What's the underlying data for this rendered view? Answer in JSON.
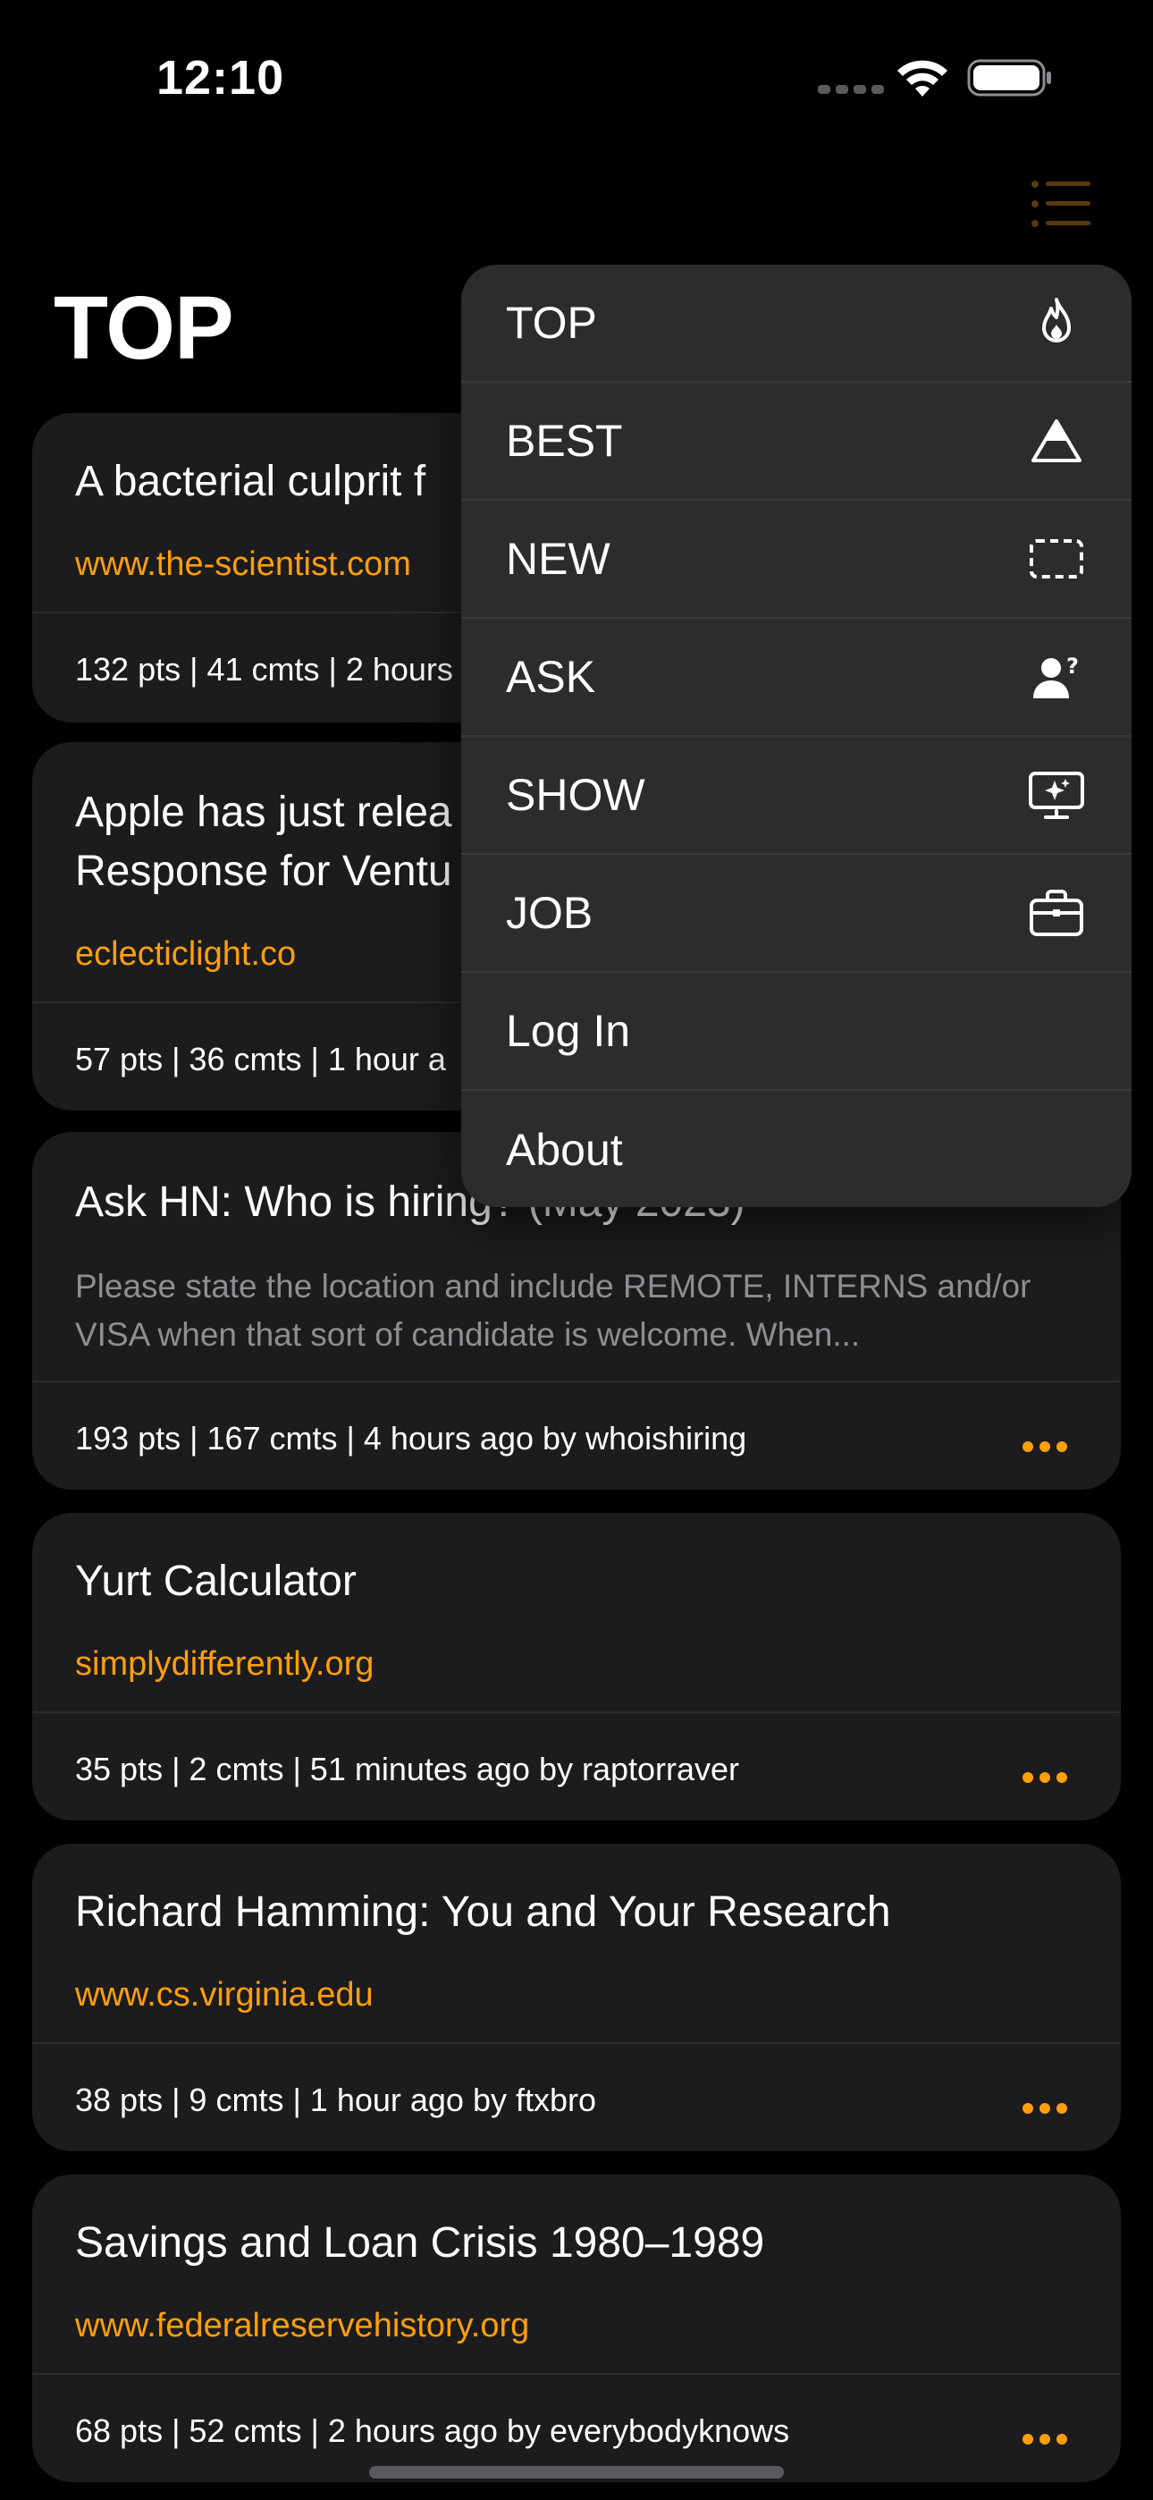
{
  "status": {
    "time": "12:10"
  },
  "page": {
    "title": "TOP"
  },
  "stories": [
    {
      "title": "A bacterial culprit f",
      "domain": "www.the-scientist.com",
      "meta": "132 pts | 41 cmts | 2 hours"
    },
    {
      "title_line1": "Apple has just relea",
      "title_line2": "Response for Ventu",
      "domain": "eclecticlight.co",
      "meta": "57 pts | 36 cmts | 1 hour a"
    },
    {
      "title": "Ask HN: Who is hiring? (May 2023)",
      "snippet": "Please state the location and include REMOTE, INTERNS and/or VISA when that sort of candidate is welcome. When...",
      "meta": "193 pts | 167 cmts | 4 hours ago by whoishiring"
    },
    {
      "title": "Yurt Calculator",
      "domain": "simplydifferently.org",
      "meta": "35 pts | 2 cmts | 51 minutes ago by raptorraver"
    },
    {
      "title": "Richard Hamming: You and Your Research",
      "domain": "www.cs.virginia.edu",
      "meta": "38 pts | 9 cmts | 1 hour ago by ftxbro"
    },
    {
      "title": "Savings and Loan Crisis 1980–1989",
      "domain": "www.federalreservehistory.org",
      "meta": "68 pts | 52 cmts | 2 hours ago by everybodyknows"
    }
  ],
  "menu": {
    "items": [
      {
        "label": "TOP",
        "icon": "flame-icon"
      },
      {
        "label": "BEST",
        "icon": "triangle-icon"
      },
      {
        "label": "NEW",
        "icon": "dashed-rect-icon"
      },
      {
        "label": "ASK",
        "icon": "person-question-icon"
      },
      {
        "label": "SHOW",
        "icon": "display-sparkle-icon"
      },
      {
        "label": "JOB",
        "icon": "briefcase-icon"
      },
      {
        "label": "Log In",
        "icon": ""
      },
      {
        "label": "About",
        "icon": ""
      }
    ]
  },
  "colors": {
    "accent": "#ff9f0a",
    "card": "#1c1c1e",
    "menu": "#2c2c2e",
    "background": "#000000"
  }
}
